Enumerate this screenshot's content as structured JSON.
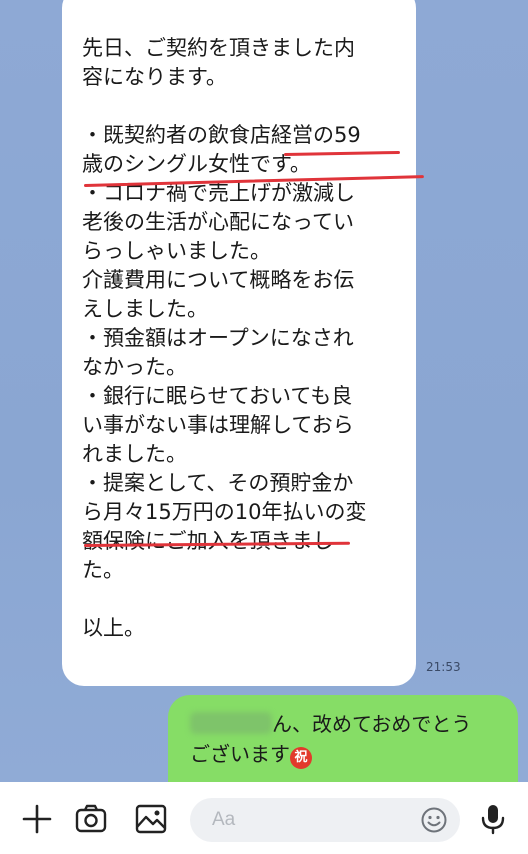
{
  "incoming_message": {
    "lines": [
      "先日、ご契約を頂きました内",
      "容になります。",
      "",
      "・既契約者の飲食店経営の59",
      "歳のシングル女性です。",
      "・コロナ禍で売上げが激減し",
      "老後の生活が心配になってい",
      "らっしゃいました。",
      "介護費用について概略をお伝",
      "えしました。",
      "・預金額はオープンになされ",
      "なかった。",
      "・銀行に眠らせておいても良",
      "い事がない事は理解しておら",
      "れました。",
      "・提案として、その預貯金か",
      "ら月々15万円の10年払いの変",
      "額保険にご加入を頂きまし",
      "た。",
      "",
      "以上。"
    ],
    "time": "21:53"
  },
  "outgoing_message": {
    "line1_suffix": "ん、改めておめでとう",
    "line2": "ございます",
    "emoji_label": "祝"
  },
  "input_bar": {
    "placeholder": "Aa"
  },
  "colors": {
    "chat_background": "#8ba7d3",
    "outgoing_bubble": "#86dd66",
    "highlight_underline": "#e0343a"
  }
}
